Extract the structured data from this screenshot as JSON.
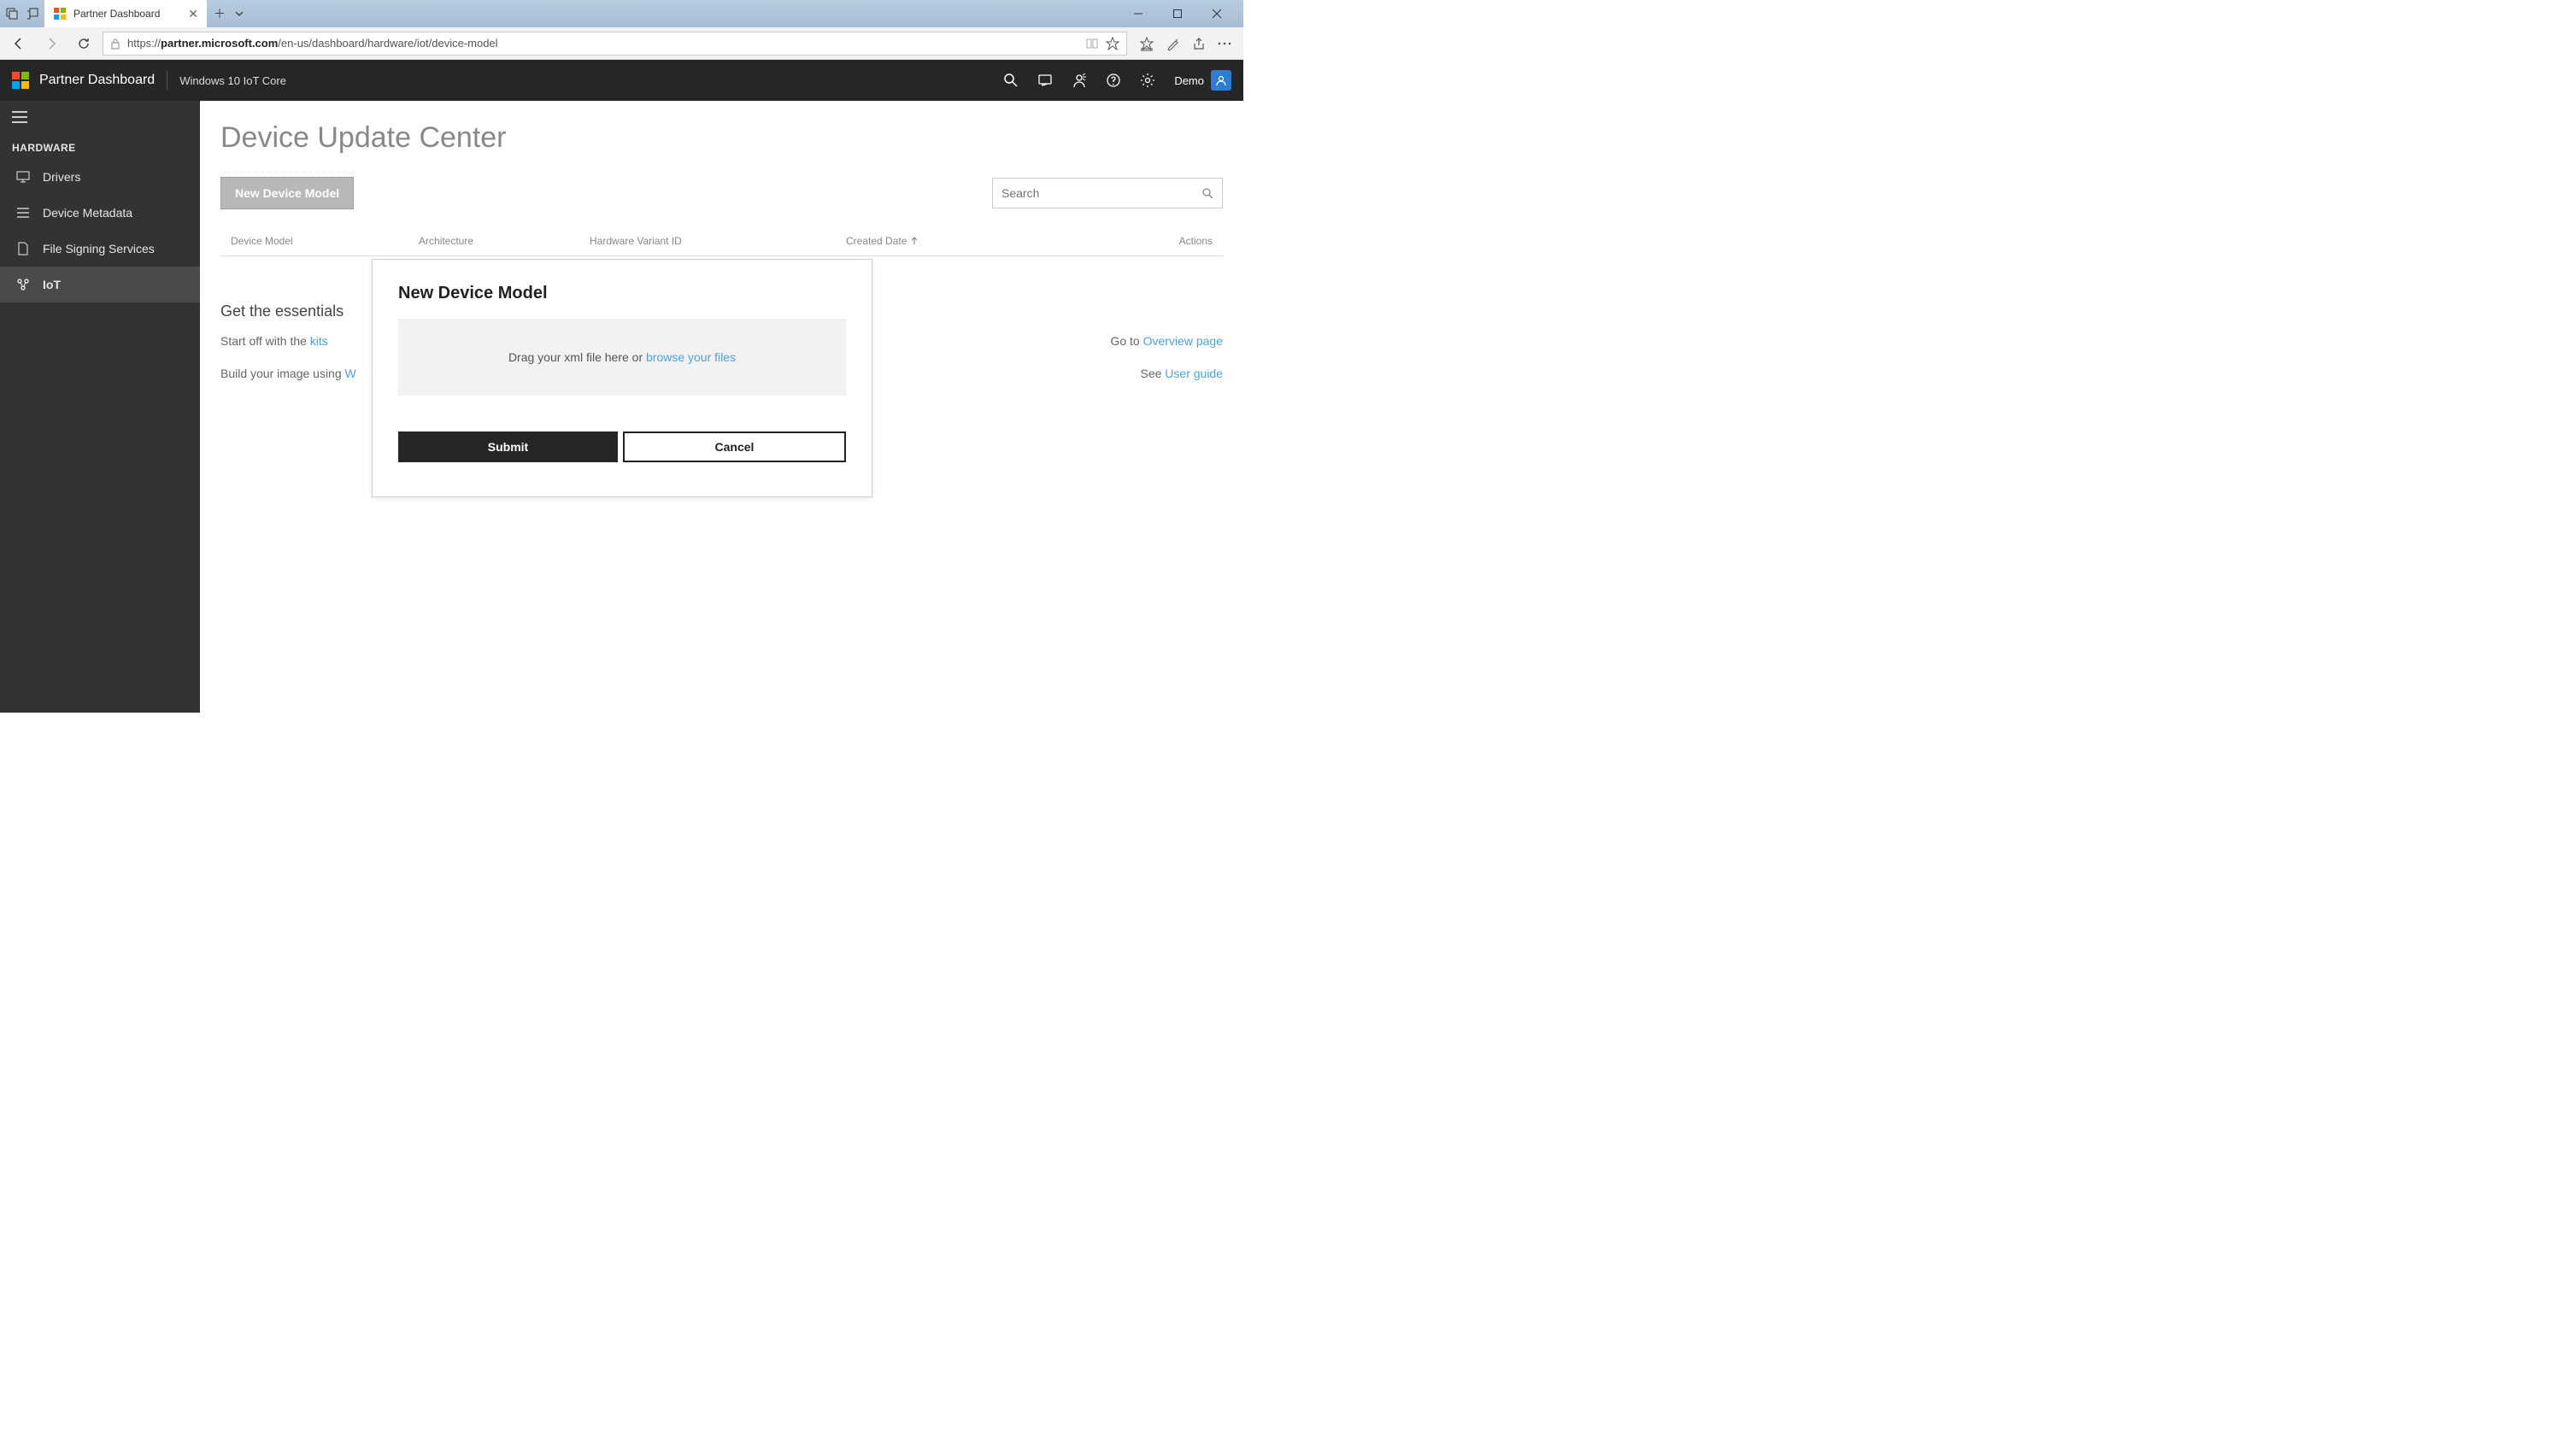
{
  "browser": {
    "tab_title": "Partner Dashboard",
    "url_host": "partner.microsoft.com",
    "url_path": "/en-us/dashboard/hardware/iot/device-model",
    "url_scheme": "https://"
  },
  "header": {
    "app_title": "Partner Dashboard",
    "subtitle": "Windows 10 IoT Core",
    "user_name": "Demo"
  },
  "sidebar": {
    "section_title": "HARDWARE",
    "items": [
      {
        "label": "Drivers"
      },
      {
        "label": "Device Metadata"
      },
      {
        "label": "File Signing Services"
      },
      {
        "label": "IoT"
      }
    ]
  },
  "main": {
    "page_title": "Device Update Center",
    "new_model_button": "New Device Model",
    "search_placeholder": "Search",
    "table": {
      "col_device": "Device Model",
      "col_arch": "Architecture",
      "col_hardware": "Hardware Variant ID",
      "col_created": "Created Date",
      "col_actions": "Actions"
    },
    "essentials": {
      "title": "Get the essentials",
      "row1_left_prefix": "Start off with the ",
      "row1_left_link": "kits",
      "row1_right_prefix": "Go to ",
      "row1_right_link": "Overview page",
      "row2_left_prefix": "Build your image using ",
      "row2_left_link": "W",
      "row2_right_prefix": "See ",
      "row2_right_link": "User guide"
    }
  },
  "modal": {
    "title": "New Device Model",
    "drop_prefix": "Drag your xml file here or ",
    "drop_link": "browse your files",
    "submit": "Submit",
    "cancel": "Cancel"
  }
}
